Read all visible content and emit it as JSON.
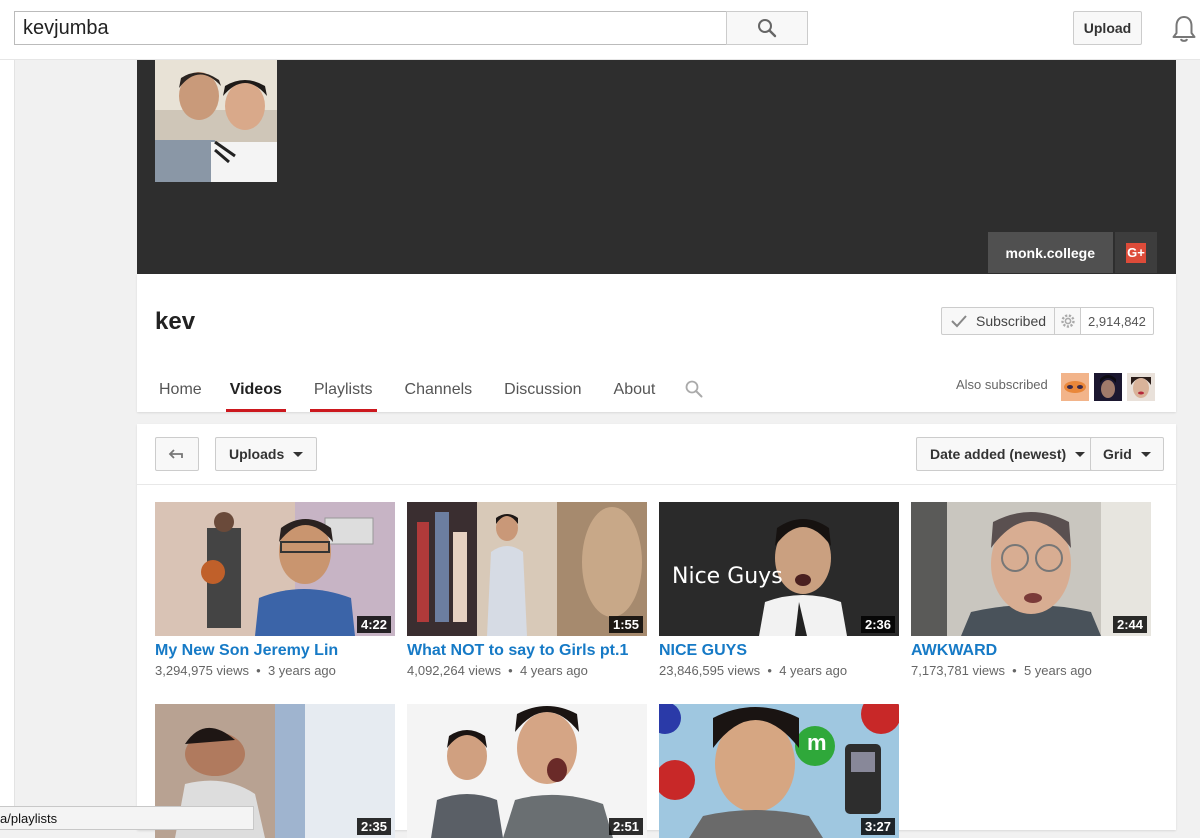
{
  "header": {
    "search_value": "kevjumba",
    "upload_label": "Upload"
  },
  "banner": {
    "link_label": "monk.college",
    "gplus_label": "G+"
  },
  "channel": {
    "name": "kev",
    "subscribed_label": "Subscribed",
    "subscriber_count": "2,914,842",
    "also_subscribed_label": "Also subscribed",
    "tabs": [
      "Home",
      "Videos",
      "Playlists",
      "Channels",
      "Discussion",
      "About"
    ]
  },
  "toolbar": {
    "uploads_label": "Uploads",
    "sort_label": "Date added (newest)",
    "view_label": "Grid"
  },
  "videos": [
    {
      "title": "My New Son Jeremy Lin",
      "views": "3,294,975 views",
      "age": "3 years ago",
      "duration": "4:22"
    },
    {
      "title": "What NOT to say to Girls pt.1",
      "views": "4,092,264 views",
      "age": "4 years ago",
      "duration": "1:55"
    },
    {
      "title": "NICE GUYS",
      "views": "23,846,595 views",
      "age": "4 years ago",
      "duration": "2:36",
      "thumb_text": "Nice Guys"
    },
    {
      "title": "AWKWARD",
      "views": "7,173,781 views",
      "age": "5 years ago",
      "duration": "2:44"
    },
    {
      "duration": "2:35"
    },
    {
      "duration": "2:51"
    },
    {
      "duration": "3:27",
      "thumb_letter": "m"
    }
  ],
  "statusbar": {
    "url": "a/playlists"
  },
  "colors": {
    "accent_red": "#cc181e",
    "link_blue": "#167ac6",
    "banner_bg": "#2e2e2e"
  }
}
